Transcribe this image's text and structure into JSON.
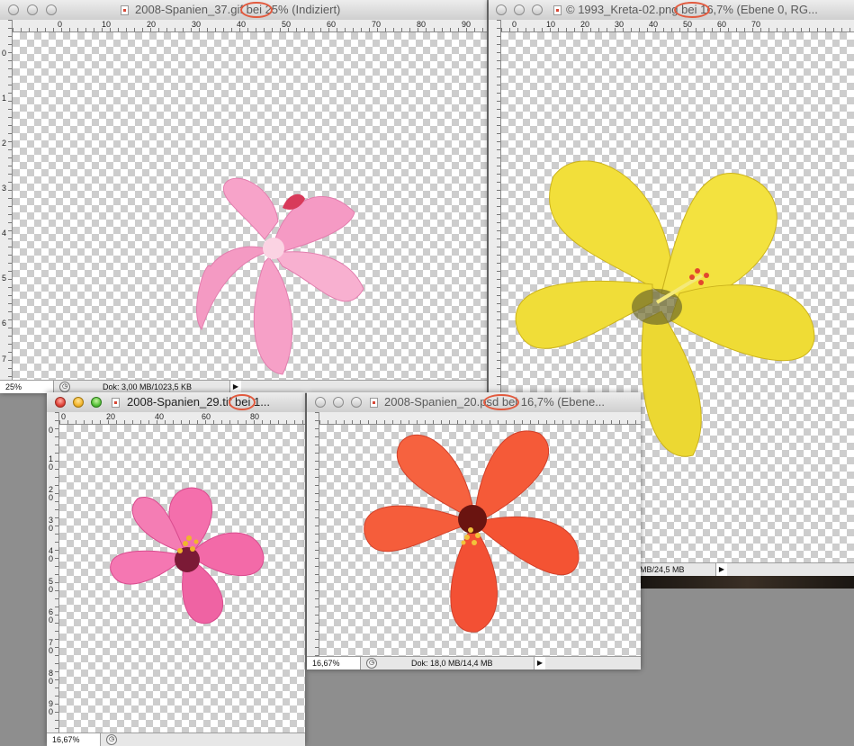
{
  "windows": {
    "gif": {
      "title_a": "2008-Spanien_37",
      "title_ext": ".gif",
      "title_b": " bei 25% (Indiziert)",
      "zoom": "25%",
      "doc_size": "Dok: 3,00 MB/1023,5 KB",
      "ruler_h": [
        "0",
        "10",
        "20",
        "30",
        "40",
        "50",
        "60",
        "70",
        "80",
        "90"
      ],
      "ruler_v": [
        "0",
        "1",
        "2",
        "3",
        "4",
        "5",
        "6",
        "7"
      ]
    },
    "png": {
      "title_a": "© 1993_Kreta-02",
      "title_ext": ".png",
      "title_b": " bei 16,7% (Ebene 0, RG...",
      "doc_size": "MB/24,5 MB",
      "ruler_h": [
        "0",
        "10",
        "20",
        "30",
        "40",
        "50",
        "60",
        "70"
      ]
    },
    "tif": {
      "title_a": "2008-Spanien_29",
      "title_ext": ".tif",
      "title_b": " bei 1...",
      "zoom": "16,67%",
      "ruler_h": [
        "0",
        "20",
        "40",
        "60",
        "80"
      ],
      "ruler_v": [
        "0",
        "1 0",
        "2 0",
        "3 0",
        "4 0",
        "5 0",
        "6 0",
        "7 0",
        "8 0",
        "9 0"
      ]
    },
    "psd": {
      "title_a": "2008-Spanien_20",
      "title_ext": ".psd",
      "title_b": " bei 16,7% (Ebene...",
      "zoom": "16,67%",
      "doc_size": "Dok: 18,0 MB/14,4 MB"
    }
  },
  "colors": {
    "highlight": "#e25a3e",
    "gif_flower": "#f59ac4",
    "png_flower": "#f2e23c",
    "tif_flower": "#f066a6",
    "psd_flower": "#f5563a"
  }
}
